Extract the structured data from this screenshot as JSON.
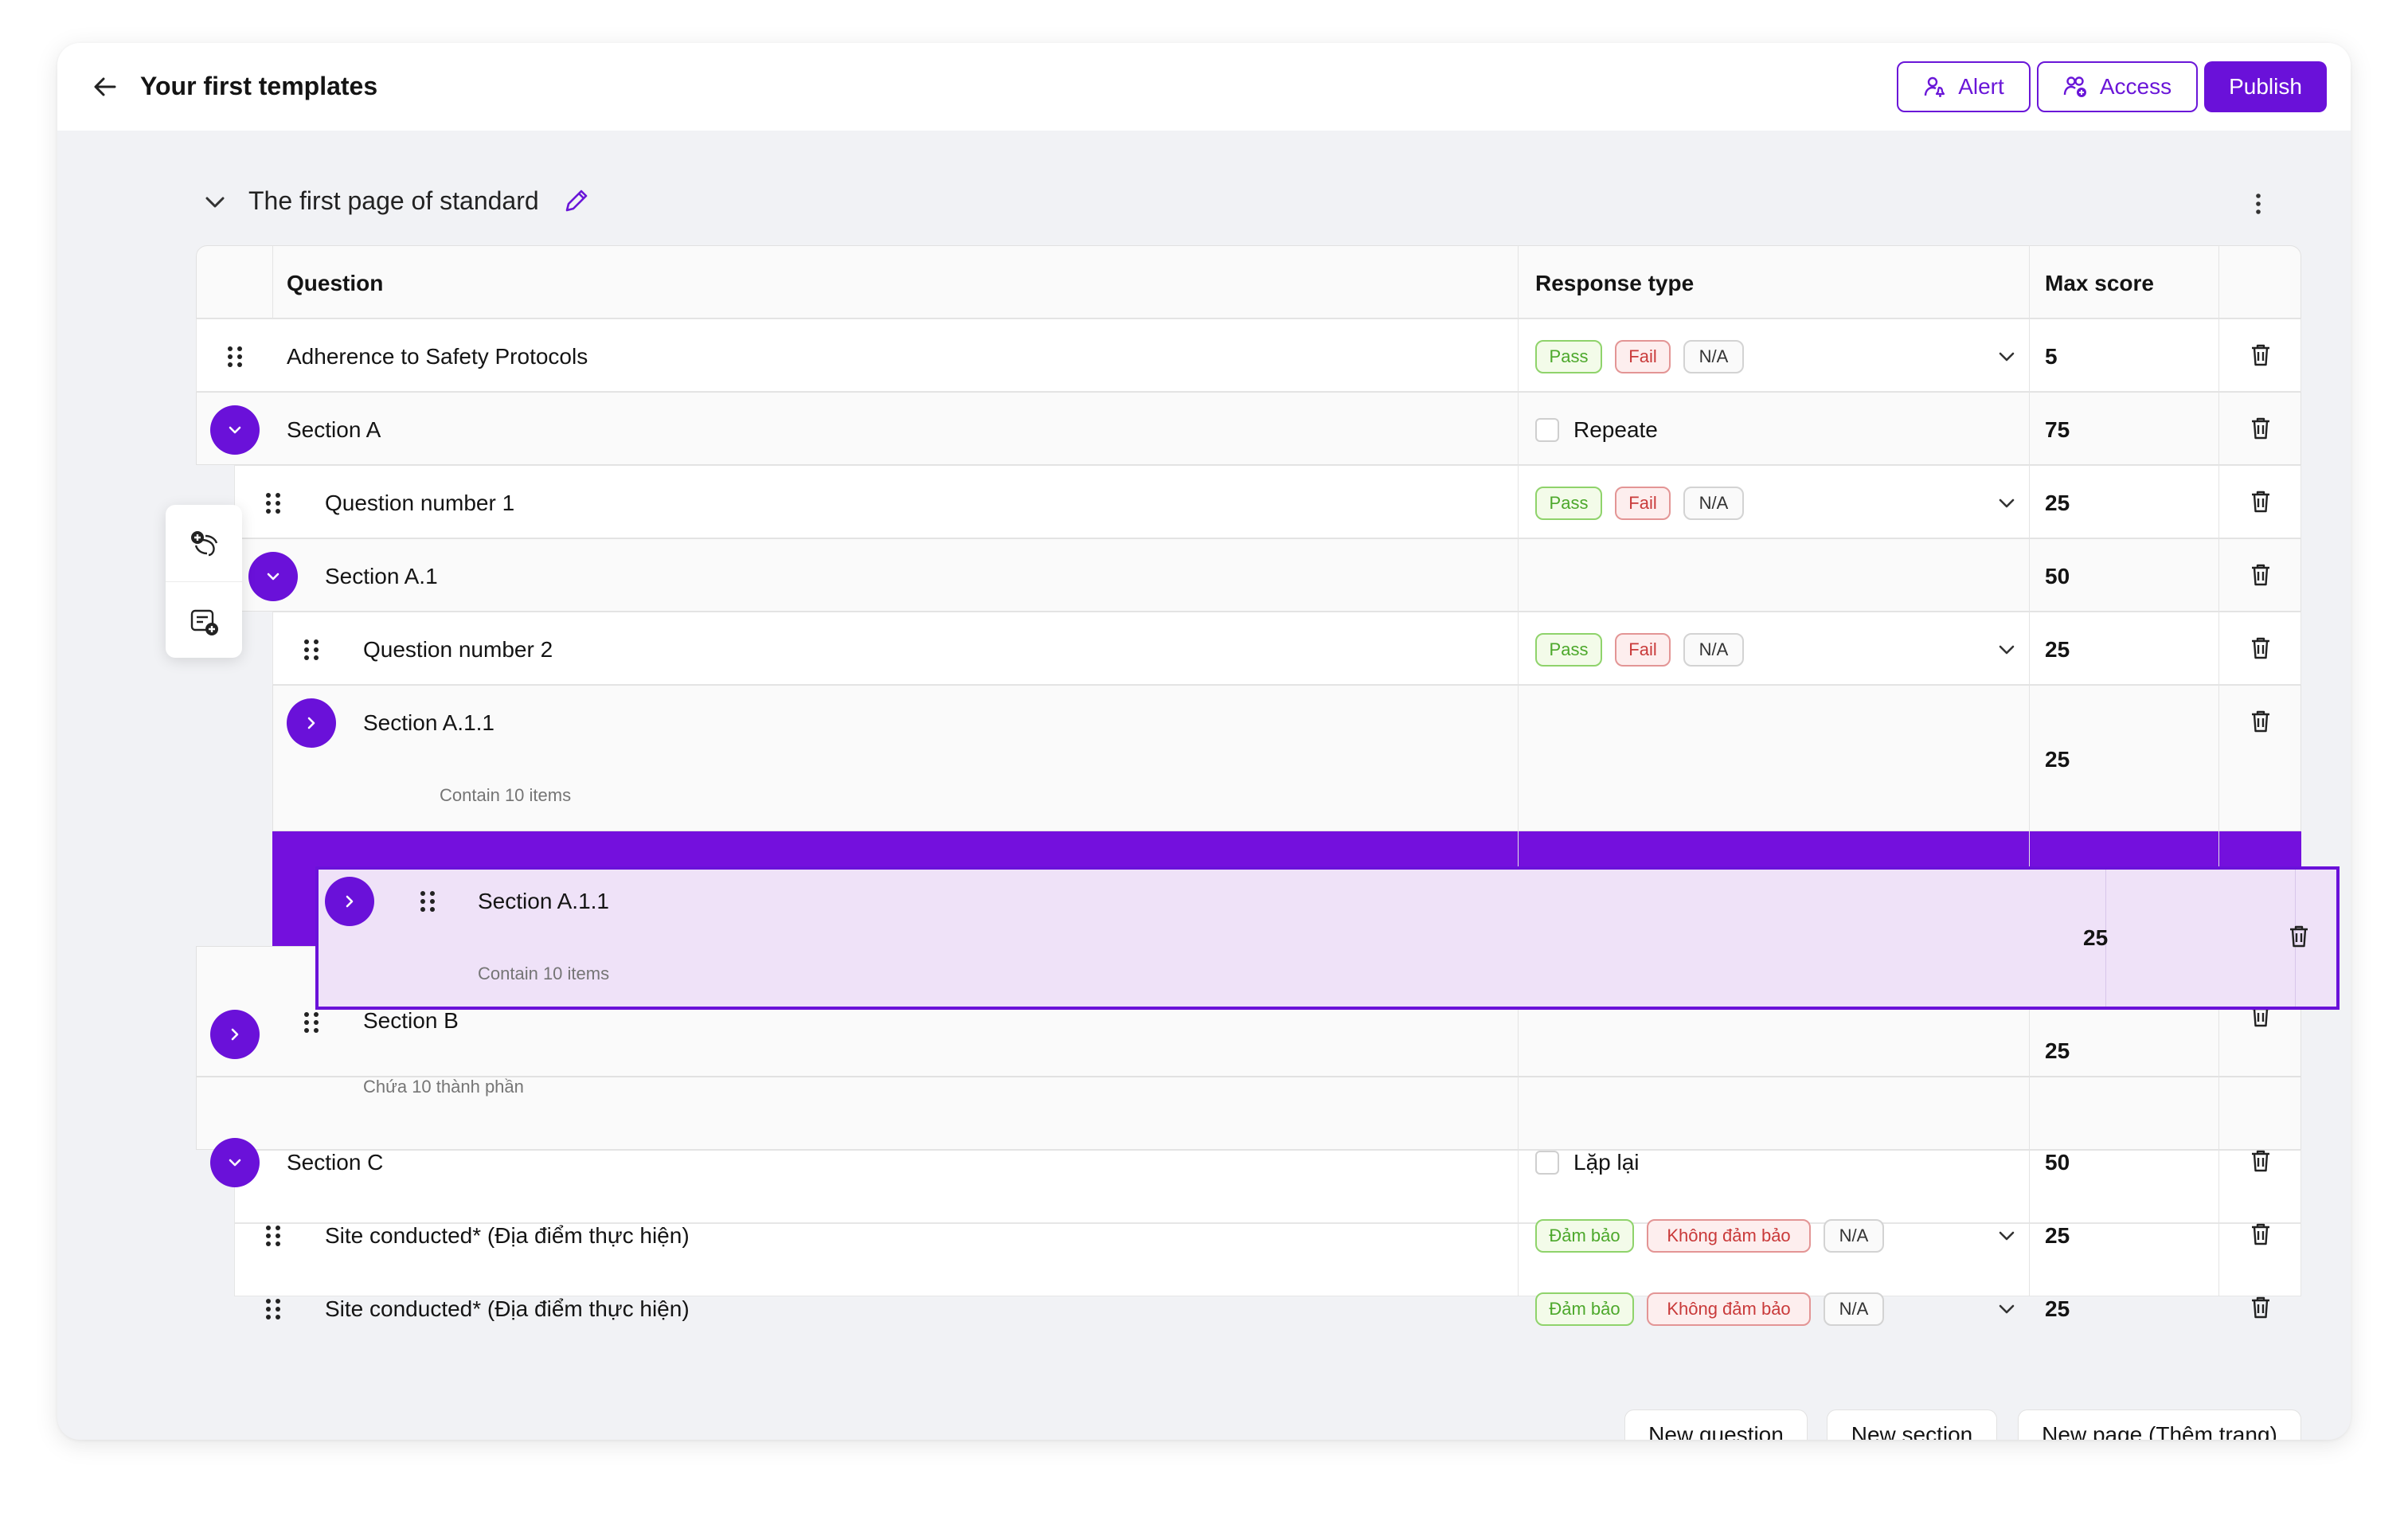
{
  "header": {
    "title": "Your first templates",
    "alert_label": "Alert",
    "access_label": "Access",
    "publish_label": "Publish"
  },
  "page": {
    "title": "The first page of standard"
  },
  "table": {
    "columns": {
      "question": "Question",
      "response_type": "Response type",
      "max_score": "Max score"
    },
    "rows": [
      {
        "label": "Adherence to Safety Protocols",
        "tags": [
          "Pass",
          "Fail",
          "N/A"
        ],
        "score": "5"
      },
      {
        "label": "Section A",
        "repeat_label": "Repeate",
        "score": "75"
      },
      {
        "label": "Question number 1",
        "tags": [
          "Pass",
          "Fail",
          "N/A"
        ],
        "score": "25"
      },
      {
        "label": "Section A.1",
        "score": "50"
      },
      {
        "label": "Question number 2",
        "tags": [
          "Pass",
          "Fail",
          "N/A"
        ],
        "score": "25"
      },
      {
        "label": "Section A.1.1",
        "sub": "Contain 10 items",
        "score": "25"
      },
      {
        "label": "Section B",
        "sub": "Chứa 10 thành phần",
        "score": "25"
      },
      {
        "label": "Section C",
        "repeat_label": "Lặp lại",
        "score": "50"
      },
      {
        "label": "Site conducted* (Địa điểm thực hiện)",
        "tags": [
          "Đảm bảo",
          "Không đảm bảo",
          "N/A"
        ],
        "score": "25"
      },
      {
        "label": "Site conducted* (Địa điểm thực hiện)",
        "tags": [
          "Đảm bảo",
          "Không đảm bảo",
          "N/A"
        ],
        "score": "25"
      }
    ]
  },
  "drag_preview": {
    "label": "Section A.1.1",
    "sub": "Contain 10 items",
    "score": "25"
  },
  "footer": {
    "new_question": "New question",
    "new_section": "New section",
    "new_page": "New page (Thêm trang)"
  },
  "colors": {
    "accent": "#6a11d9",
    "drop_zone": "#7410dd",
    "drag_bg": "#efe2f8"
  },
  "icons": [
    "back-arrow-icon",
    "alert-user-icon",
    "access-users-icon",
    "chevron-down-icon",
    "pencil-icon",
    "kebab-icon",
    "drag-handle-icon",
    "trash-icon",
    "chevron-right-icon",
    "add-question-icon",
    "add-section-icon"
  ]
}
